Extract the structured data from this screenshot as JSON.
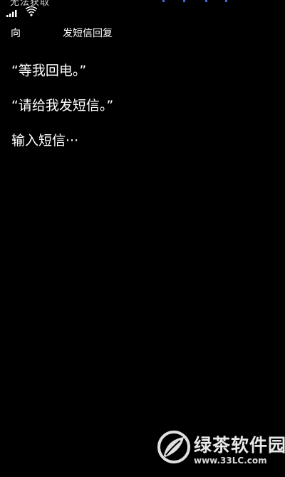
{
  "status_bar": {
    "carrier_text": "无法获取",
    "signal_icon": "signal-bars-icon",
    "wifi_icon": "wifi-icon"
  },
  "header": {
    "direction_label": "向",
    "title": "发短信回复"
  },
  "reply_options": [
    {
      "label": "“等我回电。”"
    },
    {
      "label": "“请给我发短信。”"
    },
    {
      "label": "输入短信···"
    }
  ],
  "watermark": {
    "name": "绿茶软件园",
    "url": "www.33LC.com"
  },
  "colors": {
    "background": "#000000",
    "text": "#ffffff",
    "accent": "#4a66d8"
  }
}
